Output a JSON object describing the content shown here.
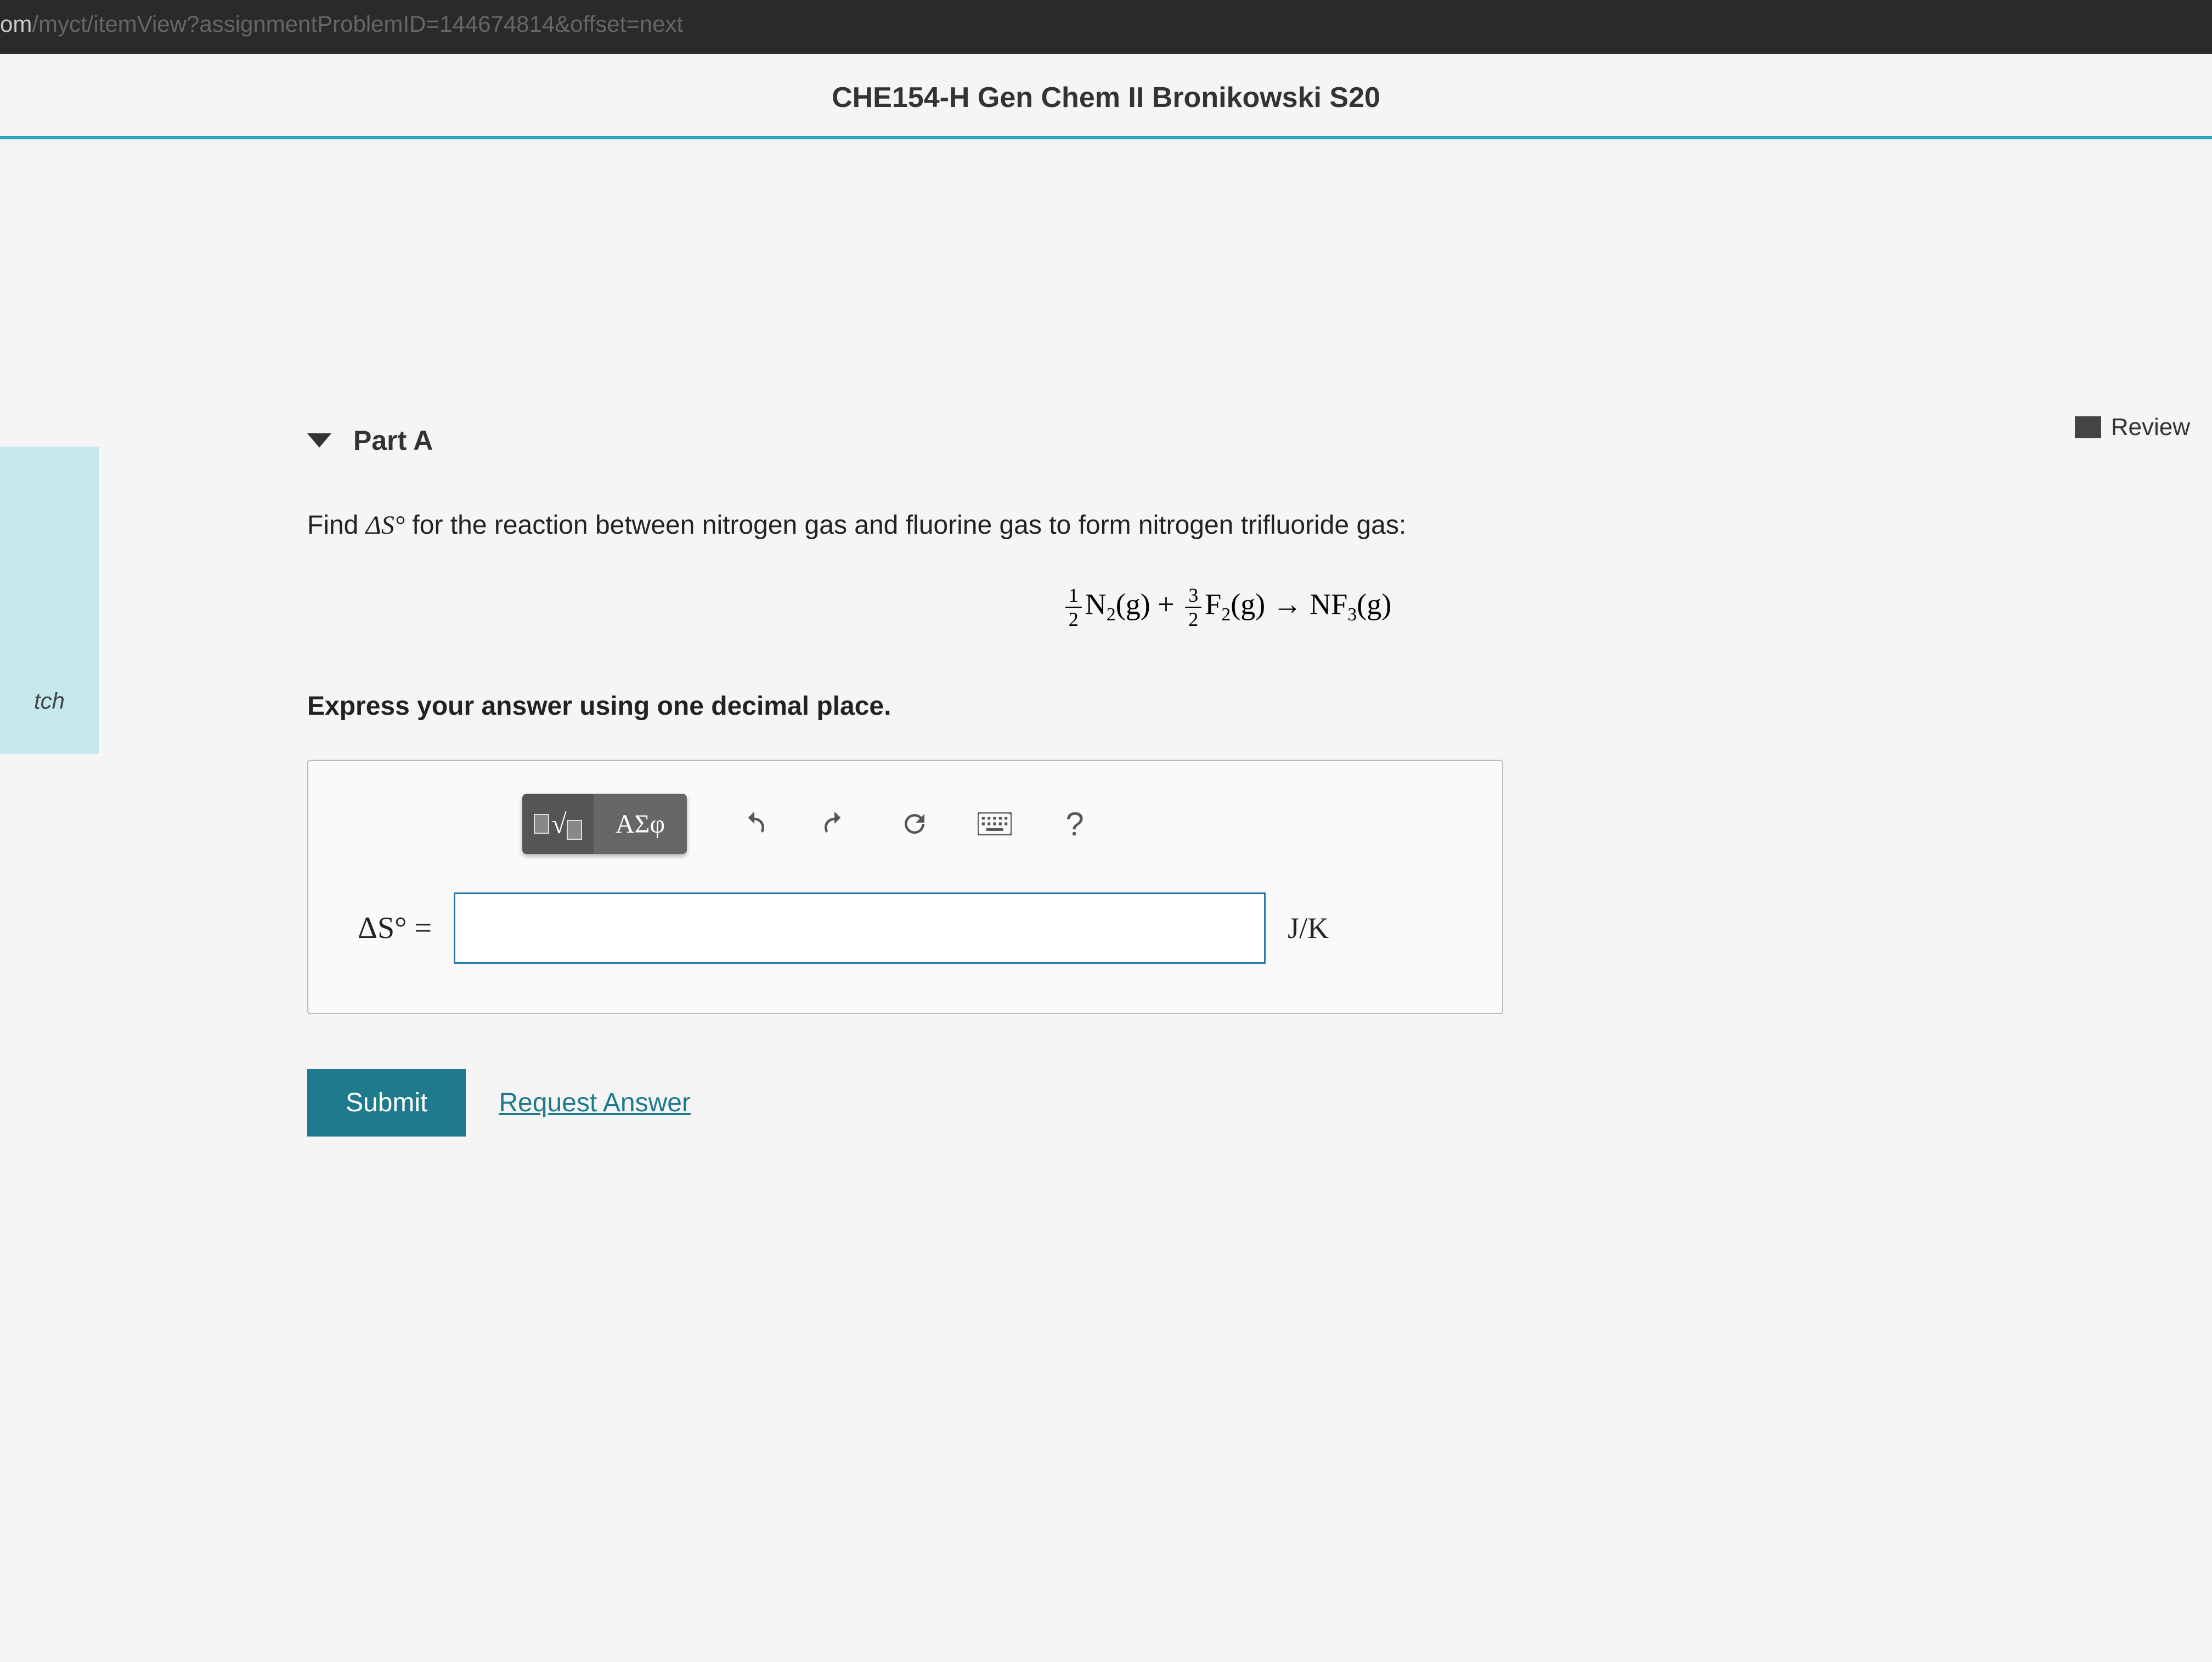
{
  "address_bar": {
    "visible_url_prefix": "om",
    "visible_url_path": "/myct/itemView?assignmentProblemID=144674814&offset=next"
  },
  "header": {
    "course_title": "CHE154-H Gen Chem II Bronikowski S20"
  },
  "sidebar": {
    "tab_label": "tch"
  },
  "review": {
    "label": "Review"
  },
  "part": {
    "label": "Part A"
  },
  "prompt": {
    "pre_text": "Find ",
    "delta_s_symbol": "ΔS°",
    "post_text": " for the reaction between nitrogen gas and fluorine gas to form nitrogen trifluoride gas:"
  },
  "equation": {
    "frac1_num": "1",
    "frac1_den": "2",
    "species1": "N",
    "species1_sub": "2",
    "phase1": "(g)",
    "plus": " + ",
    "frac2_num": "3",
    "frac2_den": "2",
    "species2": "F",
    "species2_sub": "2",
    "phase2": "(g)",
    "arrow": " → ",
    "product": "NF",
    "product_sub": "3",
    "product_phase": "(g)"
  },
  "instruction": "Express your answer using one decimal place.",
  "toolbar": {
    "greek_label": "ΑΣφ",
    "help_label": "?"
  },
  "answer": {
    "var_label": "ΔS° =",
    "value": "",
    "unit": "J/K"
  },
  "actions": {
    "submit_label": "Submit",
    "request_label": "Request Answer"
  }
}
